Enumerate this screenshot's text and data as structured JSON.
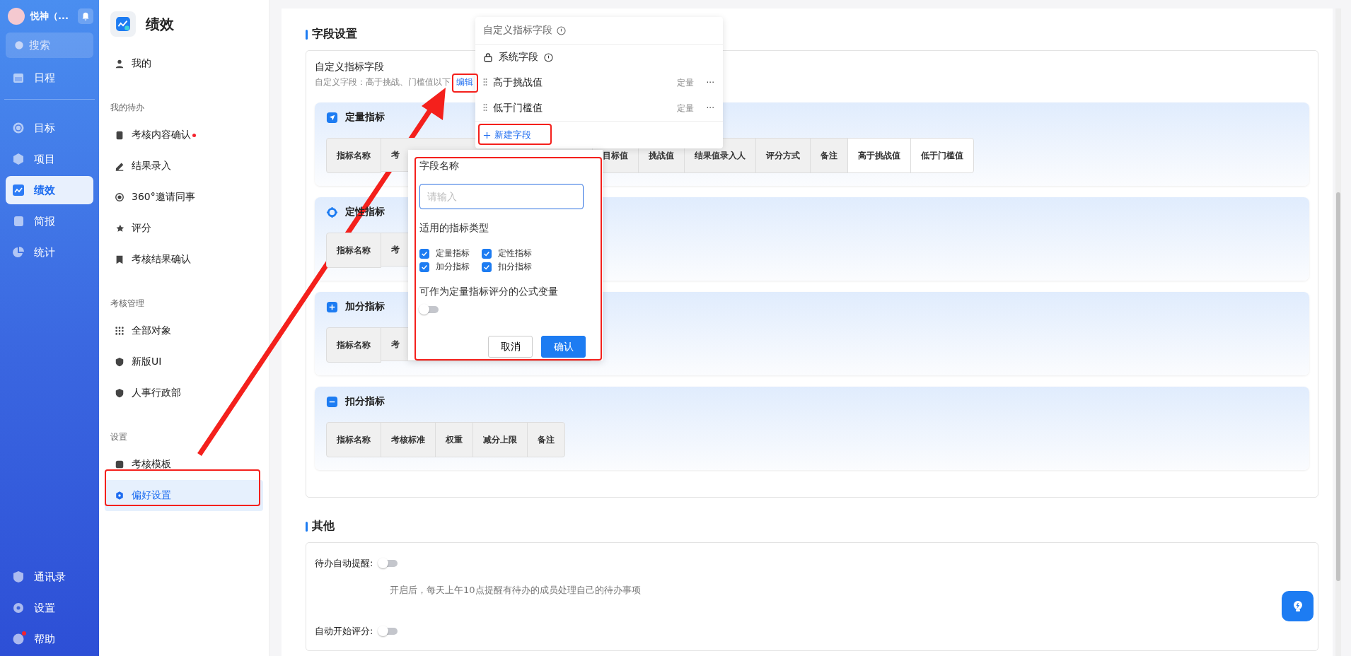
{
  "user": {
    "name": "悦神（..."
  },
  "nav": {
    "search": "搜索",
    "top": [
      {
        "label": "日程",
        "selected": false
      }
    ],
    "main": [
      {
        "label": "目标",
        "selected": false
      },
      {
        "label": "项目",
        "selected": false
      },
      {
        "label": "绩效",
        "selected": true
      },
      {
        "label": "简报",
        "selected": false
      },
      {
        "label": "统计",
        "selected": false
      }
    ],
    "bottom": [
      {
        "label": "通讯录",
        "dot": false
      },
      {
        "label": "设置",
        "dot": false
      },
      {
        "label": "帮助",
        "dot": true
      }
    ]
  },
  "module": {
    "title": "绩效"
  },
  "menu": [
    {
      "items": [
        {
          "label": "我的",
          "selected": false,
          "dot": false
        }
      ]
    },
    {
      "heading": "我的待办",
      "items": [
        {
          "label": "考核内容确认",
          "selected": false,
          "dot": true
        },
        {
          "label": "结果录入",
          "selected": false,
          "dot": false
        },
        {
          "label": "360°邀请同事",
          "selected": false,
          "dot": false
        },
        {
          "label": "评分",
          "selected": false,
          "dot": false
        },
        {
          "label": "考核结果确认",
          "selected": false,
          "dot": false
        }
      ]
    },
    {
      "heading": "考核管理",
      "items": [
        {
          "label": "全部对象",
          "selected": false,
          "dot": false
        },
        {
          "label": "新版UI",
          "selected": false,
          "dot": false
        },
        {
          "label": "人事行政部",
          "selected": false,
          "dot": false
        }
      ]
    },
    {
      "heading": "设置",
      "items": [
        {
          "label": "考核模板",
          "selected": false,
          "dot": false
        },
        {
          "label": "偏好设置",
          "selected": true,
          "dot": false
        }
      ]
    }
  ],
  "field_settings": {
    "heading": "字段设置",
    "custom": {
      "title": "自定义指标字段",
      "summary": "自定义字段：高于挑战、门槛值以下",
      "edit_link": "编辑"
    },
    "sections": [
      {
        "kind": "quantitative",
        "title": "定量指标",
        "columns": [
          {
            "label": "指标名称",
            "kind": "full",
            "custom": false
          },
          {
            "label": "考",
            "kind": "cut",
            "custom": false
          },
          {
            "label": "目标值",
            "kind": "full",
            "custom": false
          },
          {
            "label": "挑战值",
            "kind": "full",
            "custom": false
          },
          {
            "label": "结果值录入人",
            "kind": "full",
            "custom": false
          },
          {
            "label": "评分方式",
            "kind": "full",
            "custom": false
          },
          {
            "label": "备注",
            "kind": "full",
            "custom": false
          },
          {
            "label": "高于挑战值",
            "kind": "full",
            "custom": true
          },
          {
            "label": "低于门槛值",
            "kind": "full",
            "custom": true
          }
        ]
      },
      {
        "kind": "qualitative",
        "title": "定性指标",
        "columns": [
          {
            "label": "指标名称",
            "kind": "full",
            "custom": false
          },
          {
            "label": "考",
            "kind": "cut",
            "custom": false
          }
        ]
      },
      {
        "kind": "bonus",
        "title": "加分指标",
        "columns": [
          {
            "label": "指标名称",
            "kind": "full",
            "custom": false
          },
          {
            "label": "考",
            "kind": "cut",
            "custom": false
          }
        ]
      },
      {
        "kind": "deduction",
        "title": "扣分指标",
        "columns": [
          {
            "label": "指标名称",
            "kind": "full",
            "custom": false
          },
          {
            "label": "考核标准",
            "kind": "full",
            "custom": false
          },
          {
            "label": "权重",
            "kind": "full",
            "custom": false
          },
          {
            "label": "减分上限",
            "kind": "full",
            "custom": false
          },
          {
            "label": "备注",
            "kind": "full",
            "custom": false
          }
        ]
      }
    ]
  },
  "dropdown": {
    "header": "自定义指标字段",
    "system": "系统字段",
    "fields": [
      {
        "name": "高于挑战值",
        "type": "定量",
        "more": "···"
      },
      {
        "name": "低于门槛值",
        "type": "定量",
        "more": "···"
      }
    ],
    "add": "新建字段"
  },
  "form": {
    "name_label": "字段名称",
    "placeholder": "请输入",
    "types_label": "适用的指标类型",
    "types": [
      {
        "label": "定量指标",
        "checked": true
      },
      {
        "label": "定性指标",
        "checked": true
      },
      {
        "label": "加分指标",
        "checked": true
      },
      {
        "label": "扣分指标",
        "checked": true
      }
    ],
    "formula_label": "可作为定量指标评分的公式变量",
    "formula_on": false,
    "cancel": "取消",
    "confirm": "确认"
  },
  "other": {
    "heading": "其他",
    "settings": [
      {
        "label": "待办自动提醒:",
        "on": false,
        "hint": "开启后，每天上午10点提醒有待办的成员处理自己的待办事项"
      },
      {
        "label": "自动开始评分:",
        "on": false
      }
    ]
  }
}
